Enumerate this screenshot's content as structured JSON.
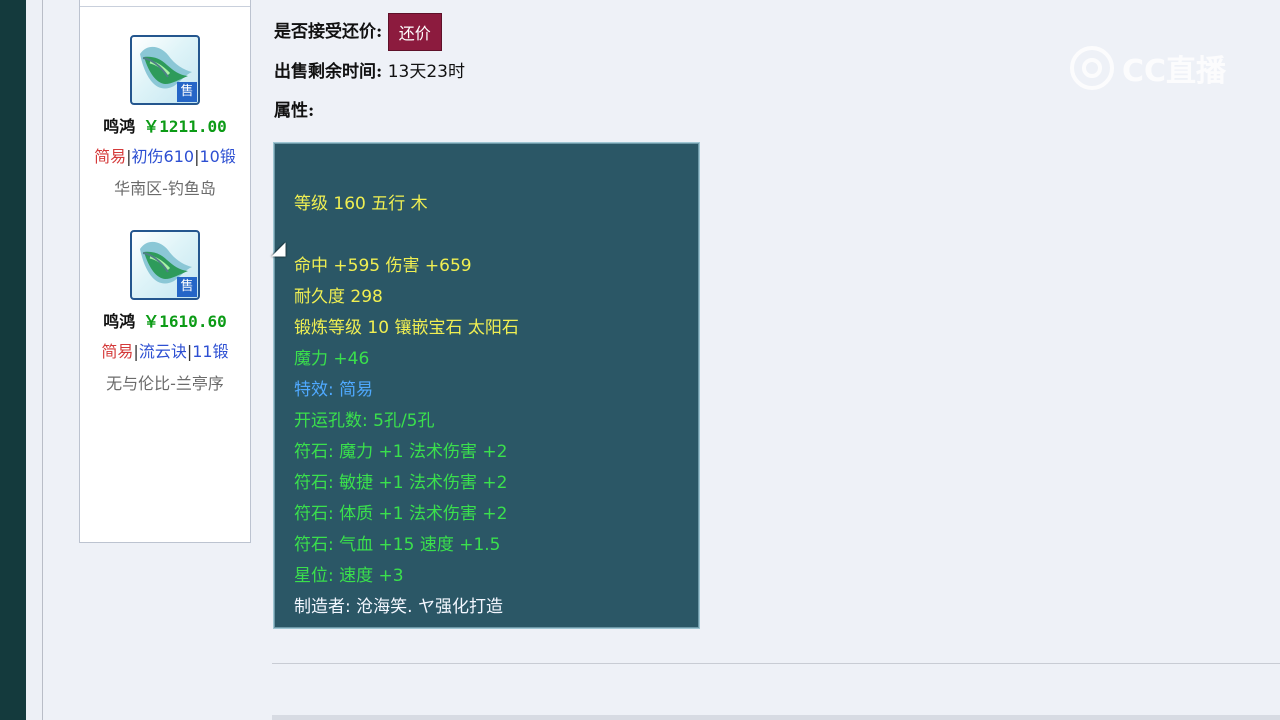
{
  "sidebar": {
    "cards": [
      {
        "icon": "weapon-icon",
        "badge": "售",
        "name": "鸣鸿",
        "price": "￥1211.00",
        "tag1": "简易",
        "tag2": "初伤610",
        "tag3": "10锻",
        "server": "华南区-钓鱼岛"
      },
      {
        "icon": "weapon-icon",
        "badge": "售",
        "name": "鸣鸿",
        "price": "￥1610.60",
        "tag1": "简易",
        "tag2": "流云诀",
        "tag3": "11锻",
        "server": "无与伦比-兰亭序"
      }
    ]
  },
  "details": {
    "accept_counter_label": "是否接受还价:",
    "counter_button": "还价",
    "remaining_time_label": "出售剩余时间:",
    "remaining_time_value": "13天23时",
    "attributes_label": "属性:"
  },
  "attributes": {
    "line1": "等级 160 五行 木",
    "line2": "命中 +595 伤害 +659",
    "line3": "耐久度 298",
    "line4": "锻炼等级 10 镶嵌宝石 太阳石",
    "line5": "魔力 +46",
    "line6": "特效: 简易",
    "line7": "开运孔数: 5孔/5孔",
    "line8": "符石: 魔力 +1 法术伤害 +2",
    "line9": "符石: 敏捷 +1 法术伤害 +2",
    "line10": "符石: 体质 +1 法术伤害 +2",
    "line11": "符石: 气血 +15 速度 +1.5",
    "line12": "星位: 速度 +3",
    "line13": "制造者: 沧海笑. ヤ强化打造"
  },
  "watermark": {
    "text": "CC直播"
  }
}
